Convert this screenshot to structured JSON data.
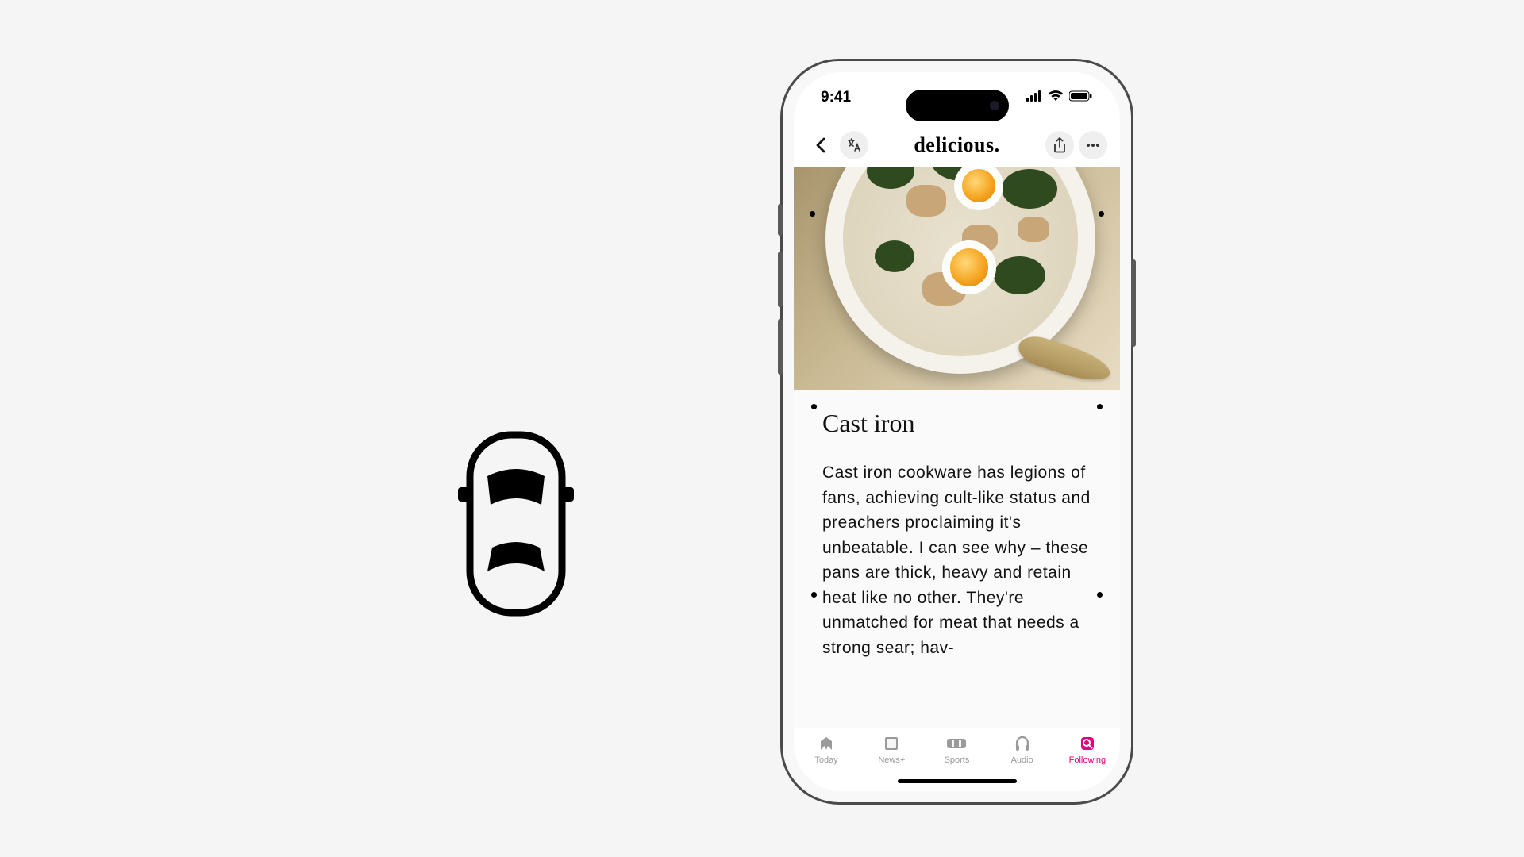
{
  "status": {
    "time": "9:41"
  },
  "nav": {
    "title": "delicious."
  },
  "article": {
    "heading": "Cast iron",
    "body": "Cast iron cookware has legions of fans, achieving cult-like status and preachers proclaiming it's unbeatable. I can see why – these pans are thick, heavy and retain heat like no other. They're unmatched for meat that needs a strong sear; hav-"
  },
  "tabs": {
    "today": "Today",
    "newsplus": "News+",
    "sports": "Sports",
    "audio": "Audio",
    "following": "Following"
  },
  "colors": {
    "accent": "#e6007e"
  }
}
